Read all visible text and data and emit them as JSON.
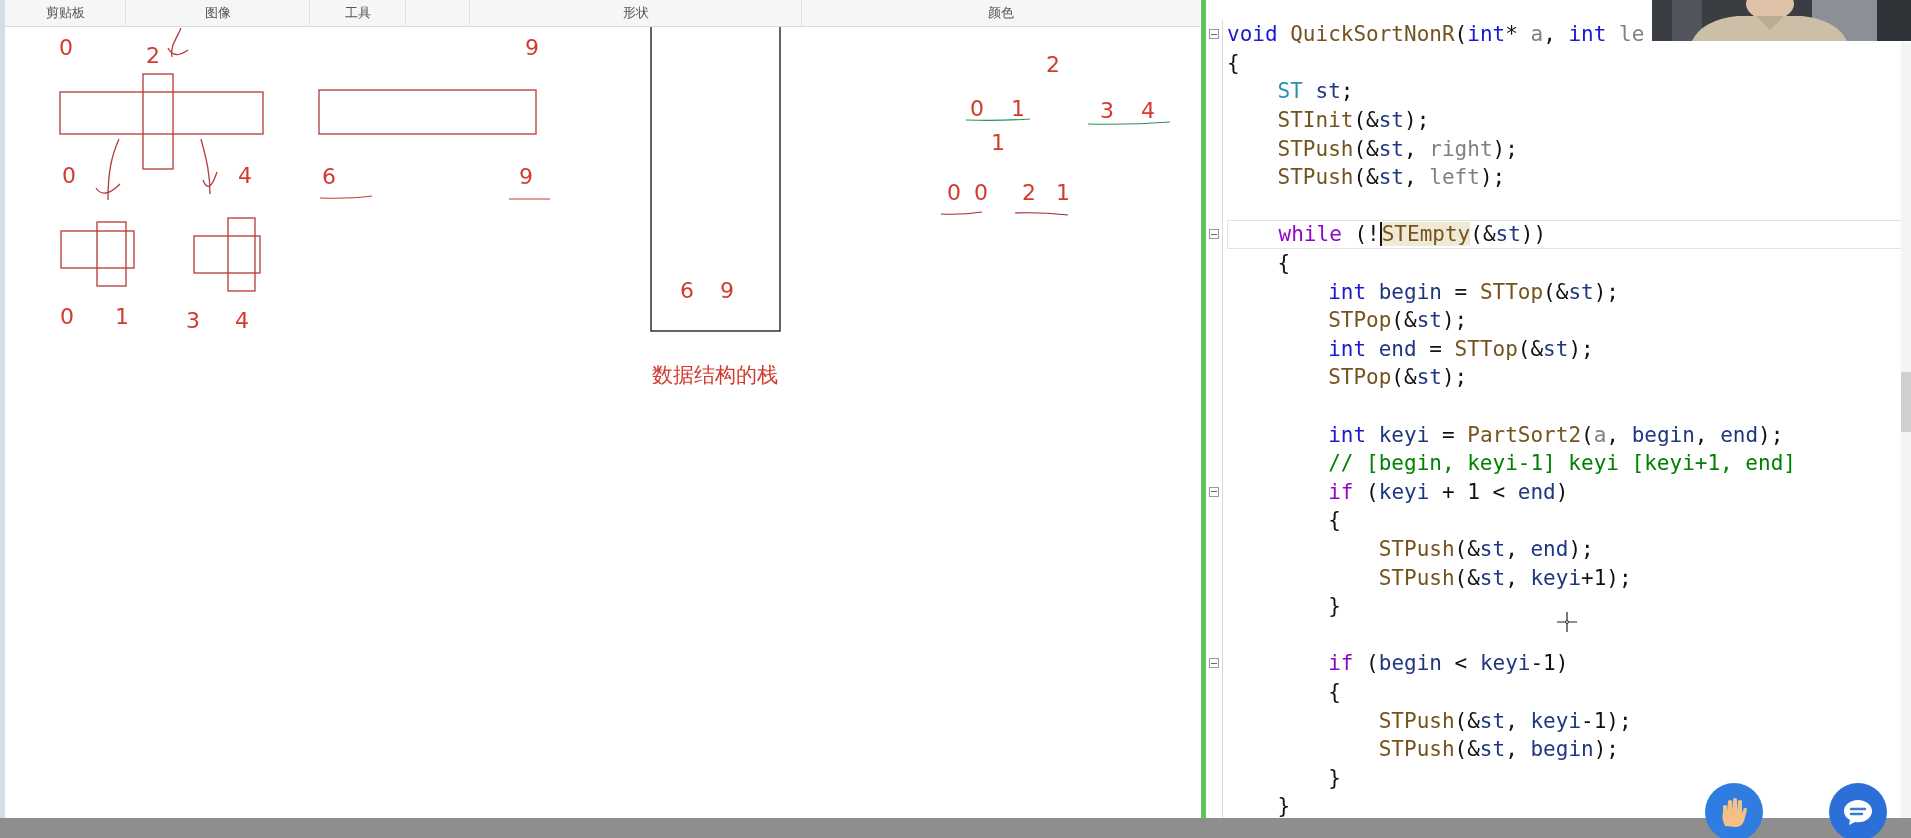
{
  "ribbon": {
    "groups": [
      "剪贴板",
      "图像",
      "工具",
      "形状",
      "颜色"
    ]
  },
  "canvas": {
    "labels": [
      "0",
      "2",
      "9",
      "0",
      "4",
      "6",
      "9",
      "0",
      "1",
      "3",
      "4",
      "6",
      "9",
      "数据结构的栈",
      "2",
      "0",
      "1",
      "3",
      "4",
      "1",
      "0",
      "0",
      "2",
      "1"
    ]
  },
  "editor": {
    "lines": [
      {
        "kind": "code",
        "fold": true,
        "current": false,
        "tokens": [
          {
            "kind": "kw",
            "text": "void "
          },
          {
            "kind": "fn",
            "text": "QuickSortNonR"
          },
          {
            "kind": "plain",
            "text": "("
          },
          {
            "kind": "kw",
            "text": "int"
          },
          {
            "kind": "plain",
            "text": "* "
          },
          {
            "kind": "param",
            "text": "a"
          },
          {
            "kind": "plain",
            "text": ", "
          },
          {
            "kind": "kw",
            "text": "int "
          },
          {
            "kind": "param",
            "text": "le"
          }
        ]
      },
      {
        "kind": "code",
        "fold": false,
        "current": false,
        "tokens": [
          {
            "kind": "plain",
            "text": "{"
          }
        ],
        "children": [
          {
            "kind": "code",
            "fold": false,
            "current": false,
            "tokens": [
              {
                "kind": "type",
                "text": "ST "
              },
              {
                "kind": "var",
                "text": "st"
              },
              {
                "kind": "plain",
                "text": ";"
              }
            ]
          },
          {
            "kind": "code",
            "fold": false,
            "current": false,
            "tokens": [
              {
                "kind": "fn",
                "text": "STInit"
              },
              {
                "kind": "plain",
                "text": "(&"
              },
              {
                "kind": "var",
                "text": "st"
              },
              {
                "kind": "plain",
                "text": ");"
              }
            ]
          },
          {
            "kind": "code",
            "fold": false,
            "current": false,
            "tokens": [
              {
                "kind": "fn",
                "text": "STPush"
              },
              {
                "kind": "plain",
                "text": "(&"
              },
              {
                "kind": "var",
                "text": "st"
              },
              {
                "kind": "plain",
                "text": ", "
              },
              {
                "kind": "param",
                "text": "right"
              },
              {
                "kind": "plain",
                "text": ");"
              }
            ]
          },
          {
            "kind": "code",
            "fold": false,
            "current": false,
            "tokens": [
              {
                "kind": "fn",
                "text": "STPush"
              },
              {
                "kind": "plain",
                "text": "(&"
              },
              {
                "kind": "var",
                "text": "st"
              },
              {
                "kind": "plain",
                "text": ", "
              },
              {
                "kind": "param",
                "text": "left"
              },
              {
                "kind": "plain",
                "text": ");"
              }
            ]
          },
          {
            "kind": "blank"
          },
          {
            "kind": "code",
            "fold": true,
            "current": true,
            "tokens": [
              {
                "kind": "ctl",
                "text": "while"
              },
              {
                "kind": "plain",
                "text": " (!"
              },
              {
                "kind": "match",
                "text": "STEmpty"
              },
              {
                "kind": "plain",
                "text": "(&"
              },
              {
                "kind": "var",
                "text": "st"
              },
              {
                "kind": "plain",
                "text": "))"
              }
            ]
          },
          {
            "kind": "code",
            "fold": false,
            "current": false,
            "tokens": [
              {
                "kind": "plain",
                "text": "{"
              }
            ],
            "children": [
              {
                "kind": "code",
                "fold": false,
                "current": false,
                "tokens": [
                  {
                    "kind": "kw",
                    "text": "int "
                  },
                  {
                    "kind": "var",
                    "text": "begin"
                  },
                  {
                    "kind": "plain",
                    "text": " = "
                  },
                  {
                    "kind": "fn",
                    "text": "STTop"
                  },
                  {
                    "kind": "plain",
                    "text": "(&"
                  },
                  {
                    "kind": "var",
                    "text": "st"
                  },
                  {
                    "kind": "plain",
                    "text": ");"
                  }
                ]
              },
              {
                "kind": "code",
                "fold": false,
                "current": false,
                "tokens": [
                  {
                    "kind": "fn",
                    "text": "STPop"
                  },
                  {
                    "kind": "plain",
                    "text": "(&"
                  },
                  {
                    "kind": "var",
                    "text": "st"
                  },
                  {
                    "kind": "plain",
                    "text": ");"
                  }
                ]
              },
              {
                "kind": "code",
                "fold": false,
                "current": false,
                "tokens": [
                  {
                    "kind": "kw",
                    "text": "int "
                  },
                  {
                    "kind": "var",
                    "text": "end"
                  },
                  {
                    "kind": "plain",
                    "text": " = "
                  },
                  {
                    "kind": "fn",
                    "text": "STTop"
                  },
                  {
                    "kind": "plain",
                    "text": "(&"
                  },
                  {
                    "kind": "var",
                    "text": "st"
                  },
                  {
                    "kind": "plain",
                    "text": ");"
                  }
                ]
              },
              {
                "kind": "code",
                "fold": false,
                "current": false,
                "tokens": [
                  {
                    "kind": "fn",
                    "text": "STPop"
                  },
                  {
                    "kind": "plain",
                    "text": "(&"
                  },
                  {
                    "kind": "var",
                    "text": "st"
                  },
                  {
                    "kind": "plain",
                    "text": ");"
                  }
                ]
              },
              {
                "kind": "blank"
              },
              {
                "kind": "code",
                "fold": false,
                "current": false,
                "tokens": [
                  {
                    "kind": "kw",
                    "text": "int "
                  },
                  {
                    "kind": "var",
                    "text": "keyi"
                  },
                  {
                    "kind": "plain",
                    "text": " = "
                  },
                  {
                    "kind": "fn",
                    "text": "PartSort2"
                  },
                  {
                    "kind": "plain",
                    "text": "("
                  },
                  {
                    "kind": "param",
                    "text": "a"
                  },
                  {
                    "kind": "plain",
                    "text": ", "
                  },
                  {
                    "kind": "var",
                    "text": "begin"
                  },
                  {
                    "kind": "plain",
                    "text": ", "
                  },
                  {
                    "kind": "var",
                    "text": "end"
                  },
                  {
                    "kind": "plain",
                    "text": ");"
                  }
                ]
              },
              {
                "kind": "code",
                "fold": false,
                "current": false,
                "tokens": [
                  {
                    "kind": "comment",
                    "text": "// [begin, keyi-1] keyi [keyi+1, end]"
                  }
                ]
              },
              {
                "kind": "code",
                "fold": true,
                "current": false,
                "tokens": [
                  {
                    "kind": "ctl",
                    "text": "if"
                  },
                  {
                    "kind": "plain",
                    "text": " ("
                  },
                  {
                    "kind": "var",
                    "text": "keyi"
                  },
                  {
                    "kind": "plain",
                    "text": " + 1 < "
                  },
                  {
                    "kind": "var",
                    "text": "end"
                  },
                  {
                    "kind": "plain",
                    "text": ")"
                  }
                ]
              },
              {
                "kind": "code",
                "fold": false,
                "current": false,
                "tokens": [
                  {
                    "kind": "plain",
                    "text": "{"
                  }
                ],
                "children": [
                  {
                    "kind": "code",
                    "fold": false,
                    "current": false,
                    "tokens": [
                      {
                        "kind": "fn",
                        "text": "STPush"
                      },
                      {
                        "kind": "plain",
                        "text": "(&"
                      },
                      {
                        "kind": "var",
                        "text": "st"
                      },
                      {
                        "kind": "plain",
                        "text": ", "
                      },
                      {
                        "kind": "var",
                        "text": "end"
                      },
                      {
                        "kind": "plain",
                        "text": ");"
                      }
                    ]
                  },
                  {
                    "kind": "code",
                    "fold": false,
                    "current": false,
                    "tokens": [
                      {
                        "kind": "fn",
                        "text": "STPush"
                      },
                      {
                        "kind": "plain",
                        "text": "(&"
                      },
                      {
                        "kind": "var",
                        "text": "st"
                      },
                      {
                        "kind": "plain",
                        "text": ", "
                      },
                      {
                        "kind": "var",
                        "text": "keyi"
                      },
                      {
                        "kind": "plain",
                        "text": "+1);"
                      }
                    ]
                  }
                ]
              },
              {
                "kind": "code",
                "fold": false,
                "current": false,
                "tokens": [
                  {
                    "kind": "plain",
                    "text": "}"
                  }
                ]
              },
              {
                "kind": "blank"
              },
              {
                "kind": "code",
                "fold": true,
                "current": false,
                "tokens": [
                  {
                    "kind": "ctl",
                    "text": "if"
                  },
                  {
                    "kind": "plain",
                    "text": " ("
                  },
                  {
                    "kind": "var",
                    "text": "begin"
                  },
                  {
                    "kind": "plain",
                    "text": " < "
                  },
                  {
                    "kind": "var",
                    "text": "keyi"
                  },
                  {
                    "kind": "plain",
                    "text": "-1)"
                  }
                ]
              },
              {
                "kind": "code",
                "fold": false,
                "current": false,
                "tokens": [
                  {
                    "kind": "plain",
                    "text": "{"
                  }
                ],
                "children": [
                  {
                    "kind": "code",
                    "fold": false,
                    "current": false,
                    "tokens": [
                      {
                        "kind": "fn",
                        "text": "STPush"
                      },
                      {
                        "kind": "plain",
                        "text": "(&"
                      },
                      {
                        "kind": "var",
                        "text": "st"
                      },
                      {
                        "kind": "plain",
                        "text": ", "
                      },
                      {
                        "kind": "var",
                        "text": "keyi"
                      },
                      {
                        "kind": "plain",
                        "text": "-1);"
                      }
                    ]
                  },
                  {
                    "kind": "code",
                    "fold": false,
                    "current": false,
                    "tokens": [
                      {
                        "kind": "fn",
                        "text": "STPush"
                      },
                      {
                        "kind": "plain",
                        "text": "(&"
                      },
                      {
                        "kind": "var",
                        "text": "st"
                      },
                      {
                        "kind": "plain",
                        "text": ", "
                      },
                      {
                        "kind": "var",
                        "text": "begin"
                      },
                      {
                        "kind": "plain",
                        "text": ");"
                      }
                    ]
                  }
                ]
              },
              {
                "kind": "code",
                "fold": false,
                "current": false,
                "tokens": [
                  {
                    "kind": "plain",
                    "text": "}"
                  }
                ]
              }
            ]
          },
          {
            "kind": "code",
            "fold": false,
            "current": false,
            "tokens": [
              {
                "kind": "plain",
                "text": "}"
              }
            ]
          }
        ]
      }
    ]
  }
}
